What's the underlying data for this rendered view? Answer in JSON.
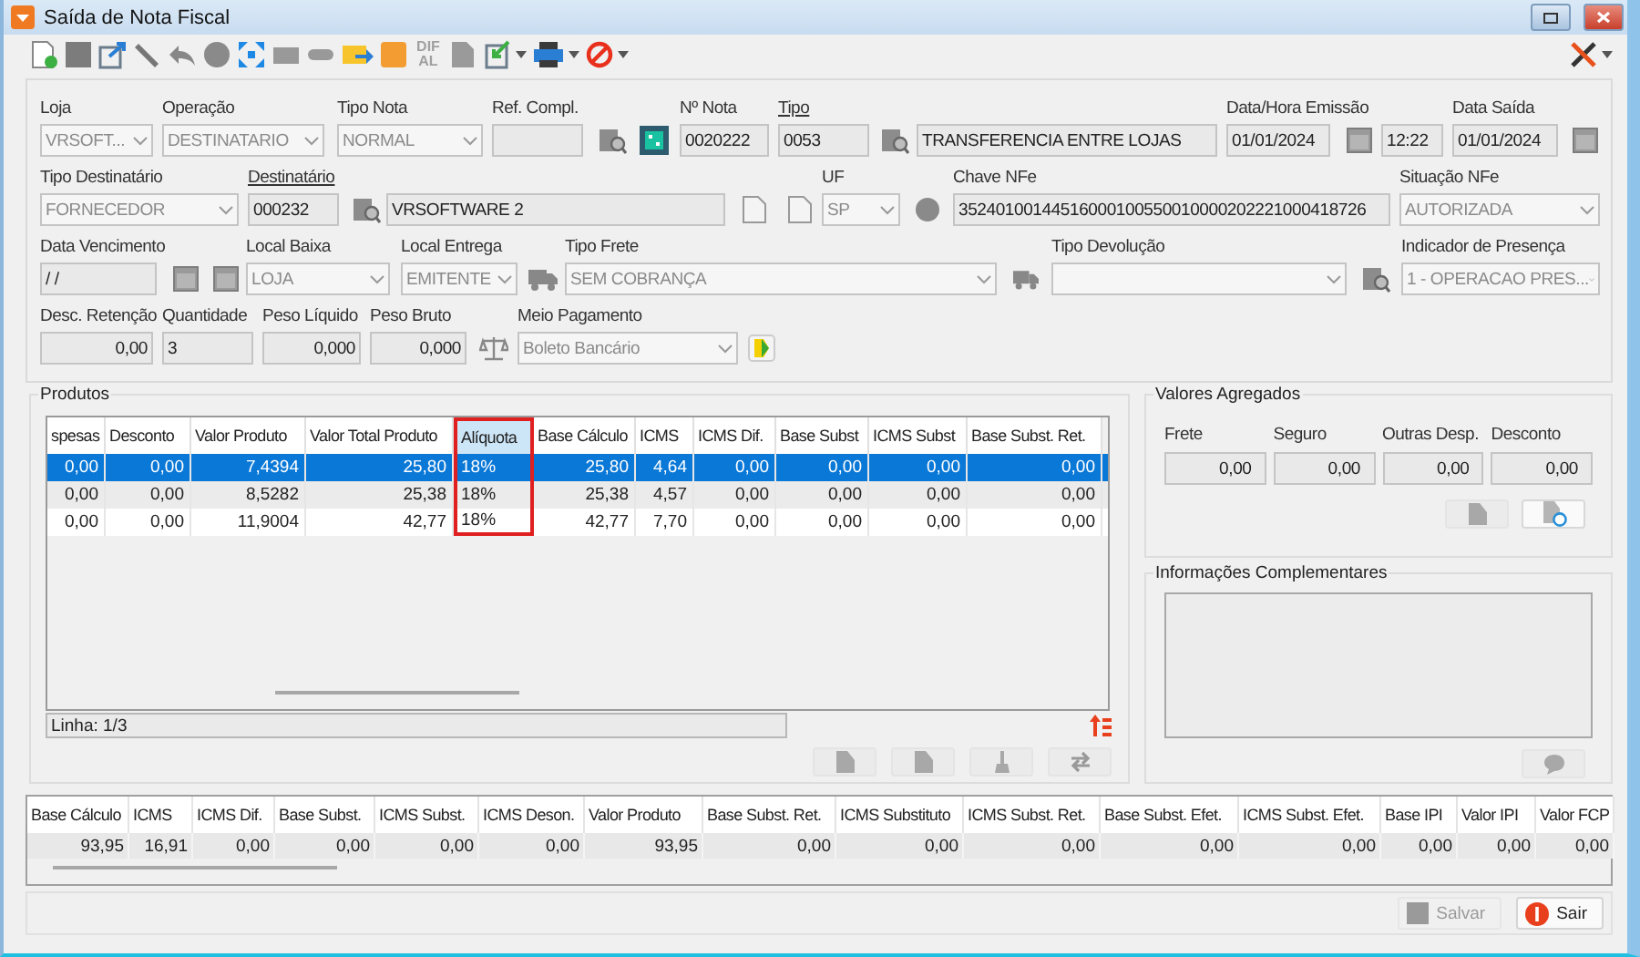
{
  "window": {
    "title": "Saída de Nota Fiscal"
  },
  "toolbar": {
    "dif_al": "DIF AL"
  },
  "form": {
    "lines": [
      {
        "items": [
          {
            "kind": "combo",
            "label": "Loja",
            "link": false,
            "value": "VRSOFT..."
          },
          {
            "kind": "combo",
            "label": "Operação",
            "link": false,
            "value": "DESTINATARIO"
          },
          {
            "kind": "combo",
            "label": "Tipo Nota",
            "link": false,
            "value": "NORMAL"
          },
          {
            "kind": "field",
            "label": "Ref. Compl.",
            "link": false
          },
          {
            "kind": "lookup"
          },
          {
            "kind": "calculator"
          },
          {
            "kind": "field",
            "label": "Nº Nota",
            "link": false,
            "value": "0020222"
          },
          {
            "kind": "field",
            "label": "Tipo",
            "link": true,
            "value": "0053"
          },
          {
            "kind": "lookup"
          },
          {
            "kind": "field",
            "value": "TRANSFERENCIA ENTRE LOJAS"
          },
          {
            "kind": "field",
            "label": "Data/Hora Emissão",
            "link": false,
            "value": "01/01/2024"
          },
          {
            "kind": "calendar"
          },
          {
            "kind": "field",
            "value": "12:22"
          },
          {
            "kind": "field",
            "label": "Data Saída",
            "link": false,
            "value": "01/01/2024"
          },
          {
            "kind": "calendar"
          }
        ]
      },
      {
        "items": [
          {
            "kind": "combo",
            "label": "Tipo Destinatário",
            "link": false,
            "value": "FORNECEDOR"
          },
          {
            "kind": "field",
            "label": "Destinatário",
            "link": true,
            "value": "000232"
          },
          {
            "kind": "lookup"
          },
          {
            "kind": "field",
            "value": "VRSOFTWARE 2"
          },
          {
            "kind": "document"
          },
          {
            "kind": "document"
          },
          {
            "kind": "combo",
            "label": "UF",
            "link": false,
            "value": "SP"
          },
          {
            "kind": "status"
          },
          {
            "kind": "field",
            "label": "Chave NFe",
            "link": false,
            "value": "35240100144516000100550010000202221000418726"
          },
          {
            "kind": "combo",
            "label": "Situação NFe",
            "link": false,
            "value": "AUTORIZADA"
          }
        ]
      },
      {
        "items": [
          {
            "kind": "field",
            "label": "Data Vencimento",
            "link": false,
            "value": "/ /"
          },
          {
            "kind": "calendar"
          },
          {
            "kind": "calendar"
          },
          {
            "kind": "combo",
            "label": "Local Baixa",
            "link": false,
            "value": "LOJA"
          },
          {
            "kind": "combo",
            "label": "Local Entrega",
            "link": false,
            "value": "EMITENTE"
          },
          {
            "kind": "truck"
          },
          {
            "kind": "combo",
            "label": "Tipo Frete",
            "link": false,
            "value": "SEM COBRANÇA"
          },
          {
            "kind": "truck"
          },
          {
            "kind": "combo",
            "label": "Tipo Devolução",
            "link": false
          },
          {
            "kind": "lookup"
          },
          {
            "kind": "combo",
            "label": "Indicador de Presença",
            "link": false,
            "value": "1 - OPERACAO PRES..."
          }
        ]
      },
      {
        "items": [
          {
            "kind": "number",
            "label": "Desc. Retenção",
            "link": false,
            "value": "0,00"
          },
          {
            "kind": "field",
            "label": "Quantidade",
            "link": false,
            "value": "3"
          },
          {
            "kind": "number",
            "label": "Peso Líquido",
            "link": false,
            "value": "0,000"
          },
          {
            "kind": "number",
            "label": "Peso Bruto",
            "link": false,
            "value": "0,000"
          },
          {
            "kind": "scale"
          },
          {
            "kind": "combo",
            "label": "Meio Pagamento",
            "link": false,
            "value": "Boleto Bancário"
          },
          {
            "kind": "money"
          }
        ]
      }
    ]
  },
  "products": {
    "title": "Produtos",
    "columns": [
      {
        "label": "spesas",
        "kind": "number",
        "highlighted": false
      },
      {
        "label": "Desconto",
        "kind": "number",
        "highlighted": false
      },
      {
        "label": "Valor Produto",
        "kind": "number",
        "highlighted": false
      },
      {
        "label": "Valor Total Produto",
        "kind": "number",
        "highlighted": false
      },
      {
        "label": "Alíquota",
        "kind": "percent",
        "highlighted": true
      },
      {
        "label": "Base Cálculo",
        "kind": "number",
        "highlighted": false
      },
      {
        "label": "ICMS",
        "kind": "number",
        "highlighted": false
      },
      {
        "label": "ICMS Dif.",
        "kind": "number",
        "highlighted": false
      },
      {
        "label": "Base Subst",
        "kind": "number",
        "highlighted": false
      },
      {
        "label": "ICMS Subst",
        "kind": "number",
        "highlighted": false
      },
      {
        "label": "Base Subst. Ret.",
        "kind": "number",
        "highlighted": false
      }
    ],
    "rows": [
      {
        "selected": true,
        "cells": [
          "0,00",
          "0,00",
          "7,4394",
          "25,80",
          "18%",
          "25,80",
          "4,64",
          "0,00",
          "0,00",
          "0,00",
          "0,00"
        ]
      },
      {
        "selected": false,
        "cells": [
          "0,00",
          "0,00",
          "8,5282",
          "25,38",
          "18%",
          "25,38",
          "4,57",
          "0,00",
          "0,00",
          "0,00",
          "0,00"
        ]
      },
      {
        "selected": false,
        "cells": [
          "0,00",
          "0,00",
          "11,9004",
          "42,77",
          "18%",
          "42,77",
          "7,70",
          "0,00",
          "0,00",
          "0,00",
          "0,00"
        ]
      }
    ],
    "status": "Linha: 1/3"
  },
  "aggregated": {
    "title": "Valores Agregados",
    "fields": [
      {
        "label": "Frete",
        "value": "0,00"
      },
      {
        "label": "Seguro",
        "value": "0,00"
      },
      {
        "label": "Outras Desp.",
        "value": "0,00"
      },
      {
        "label": "Desconto",
        "value": "0,00"
      }
    ]
  },
  "complementary": {
    "title": "Informações Complementares"
  },
  "totals": {
    "columns": [
      "Base Cálculo",
      "ICMS",
      "ICMS Dif.",
      "Base Subst.",
      "ICMS Subst.",
      "ICMS Deson.",
      "Valor Produto",
      "Base Subst. Ret.",
      "ICMS Substituto",
      "ICMS Subst. Ret.",
      "Base Subst. Efet.",
      "ICMS Subst. Efet.",
      "Base IPI",
      "Valor IPI",
      "Valor FCP"
    ],
    "values": [
      "93,95",
      "16,91",
      "0,00",
      "0,00",
      "0,00",
      "0,00",
      "93,95",
      "0,00",
      "0,00",
      "0,00",
      "0,00",
      "0,00",
      "0,00",
      "0,00",
      "0,00"
    ]
  },
  "buttons": [
    {
      "label": "Salvar",
      "disabled": true
    },
    {
      "label": "Sair",
      "disabled": false
    }
  ]
}
